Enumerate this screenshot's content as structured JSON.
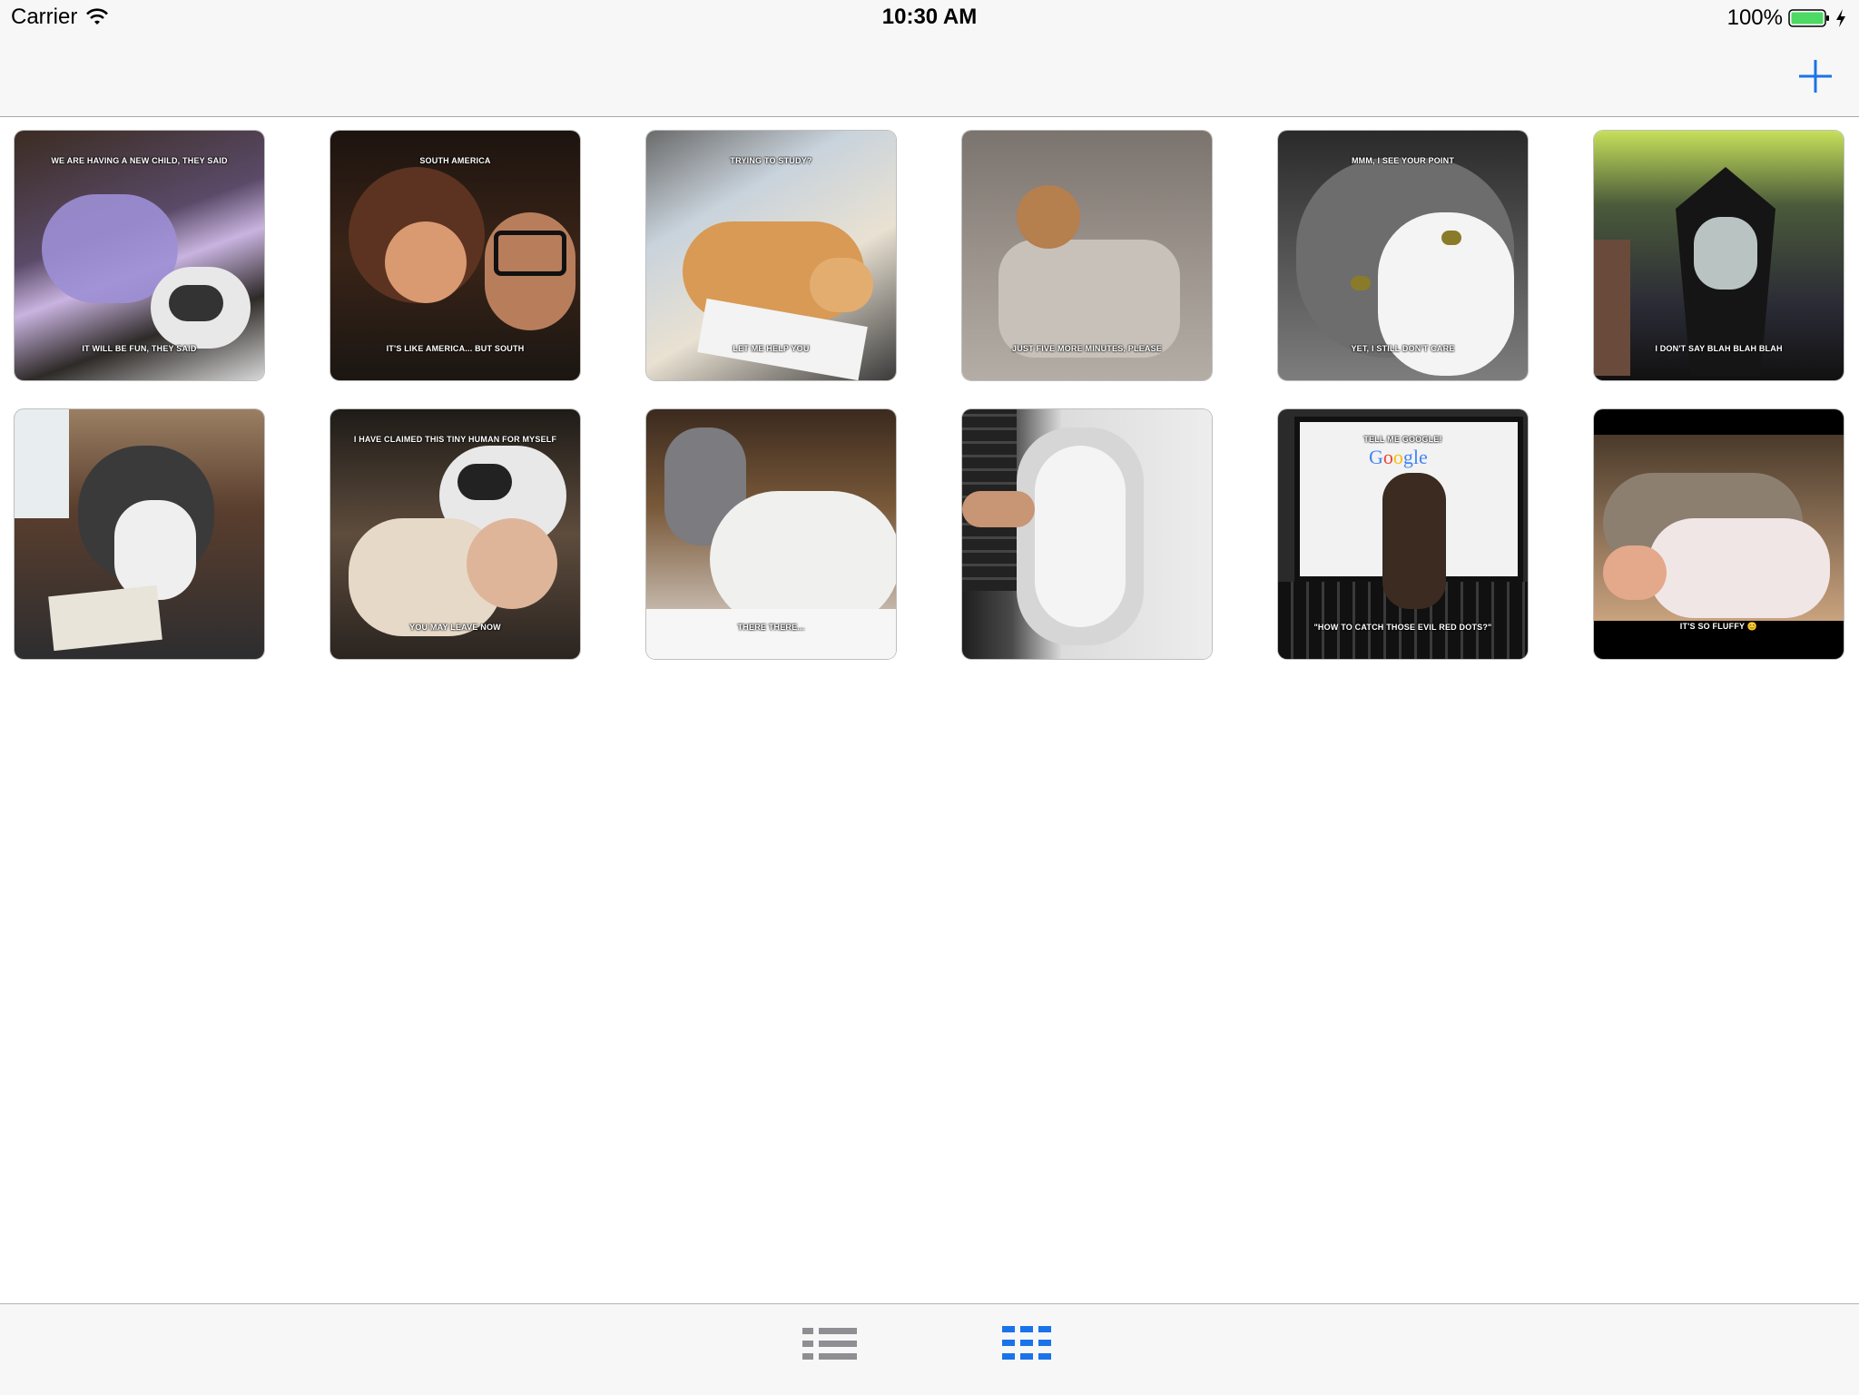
{
  "status_bar": {
    "carrier": "Carrier",
    "time": "10:30 AM",
    "battery": "100%"
  },
  "nav": {
    "add_icon": "plus-icon"
  },
  "memes": [
    {
      "top": "WE ARE HAVING A NEW CHILD, THEY SAID",
      "bottom": "IT WILL BE FUN, THEY SAID",
      "scene": "baby-and-husky"
    },
    {
      "top": "SOUTH AMERICA",
      "bottom": "IT'S LIKE AMERICA... BUT SOUTH",
      "scene": "cartoon-kids"
    },
    {
      "top": "TRYING TO STUDY?",
      "bottom": "LET ME HELP YOU",
      "scene": "orange-cat-on-papers"
    },
    {
      "top": "",
      "bottom": "JUST FIVE MORE MINUTES, PLEASE",
      "scene": "kitten-in-blanket"
    },
    {
      "top": "MMM, I SEE YOUR POINT",
      "bottom": "YET, I STILL DON'T CARE",
      "scene": "grey-white-cat"
    },
    {
      "top": "",
      "bottom": "I DON'T SAY BLAH BLAH BLAH",
      "scene": "cartoon-vampire"
    },
    {
      "top": "",
      "bottom": "",
      "scene": "husky-with-glasses"
    },
    {
      "top": "I HAVE CLAIMED THIS TINY HUMAN FOR MYSELF",
      "bottom": "YOU MAY LEAVE NOW",
      "scene": "cat-on-baby"
    },
    {
      "top": "",
      "bottom": "THERE THERE...",
      "scene": "cat-and-white-dog"
    },
    {
      "top": "",
      "bottom": "",
      "scene": "cat-upside-down"
    },
    {
      "top": "TELL ME GOOGLE!",
      "bottom": "\"HOW TO CATCH THOSE EVIL RED DOTS?\"",
      "scene": "kitten-at-laptop"
    },
    {
      "top": "",
      "bottom": "IT'S SO FLUFFY 😊",
      "scene": "baby-on-cat"
    }
  ],
  "tabs": {
    "list_icon": "list-icon",
    "grid_icon": "grid-icon",
    "active": "grid"
  },
  "colors": {
    "accent": "#1a73e8",
    "inactive": "#8e8e93",
    "battery_green": "#4cd964"
  }
}
